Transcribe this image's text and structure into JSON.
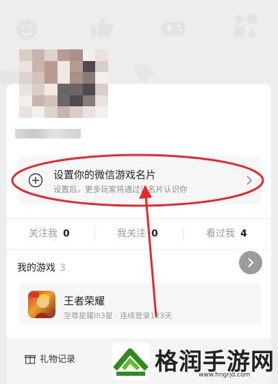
{
  "namecard": {
    "title": "设置你的微信游戏名片",
    "subtitle": "设置后，更多玩家将通过该名片认识你"
  },
  "stats": [
    {
      "label": "关注我",
      "value": "0"
    },
    {
      "label": "我关注",
      "value": "0"
    },
    {
      "label": "看过我",
      "value": "4"
    }
  ],
  "games": {
    "title": "我的游戏",
    "count": "3",
    "items": [
      {
        "name": "王者荣耀",
        "detail": "至尊星耀III3星 · 连续登录123天"
      }
    ]
  },
  "bottom": {
    "gift_label": "礼物记录"
  },
  "watermark": {
    "text": "格润手游网",
    "url": "www.hngrjd.com"
  },
  "colors": {
    "annotation_red": "#e8262a",
    "background": "#ededed",
    "card": "#ffffff"
  }
}
